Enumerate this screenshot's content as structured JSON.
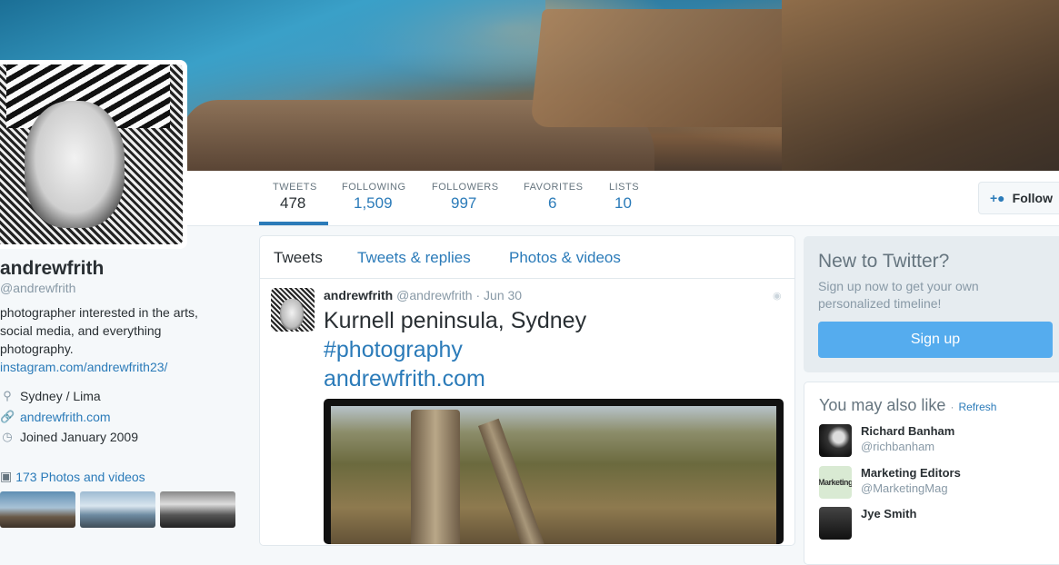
{
  "profile": {
    "name": "andrewfrith",
    "handle": "@andrewfrith",
    "bio": "photographer interested in the arts, social media, and everything photography.",
    "bio_link": "instagram.com/andrewfrith23/",
    "location": "Sydney / Lima",
    "website": "andrewfrith.com",
    "joined": "Joined January 2009",
    "photos_link": "173 Photos and videos",
    "icons": {
      "location": "map-pin-icon",
      "website": "link-icon",
      "joined": "clock-icon",
      "photos": "camera-icon"
    }
  },
  "nav": {
    "stats": [
      {
        "label": "TWEETS",
        "value": "478",
        "active": true
      },
      {
        "label": "FOLLOWING",
        "value": "1,509"
      },
      {
        "label": "FOLLOWERS",
        "value": "997"
      },
      {
        "label": "FAVORITES",
        "value": "6"
      },
      {
        "label": "LISTS",
        "value": "10"
      }
    ],
    "follow_label": "Follow"
  },
  "timeline": {
    "tabs": [
      "Tweets",
      "Tweets & replies",
      "Photos & videos"
    ],
    "active_tab": "Tweets",
    "tweet": {
      "name": "andrewfrith",
      "handle": "@andrewfrith",
      "dot": "·",
      "date": "Jun 30",
      "text": "Kurnell peninsula, Sydney",
      "hashtag": "#photography",
      "url": "andrewfrith.com"
    }
  },
  "signup": {
    "title": "New to Twitter?",
    "subtitle": "Sign up now to get your own personalized timeline!",
    "button": "Sign up"
  },
  "who_to_follow": {
    "title": "You may also like",
    "separator": "·",
    "refresh": "Refresh",
    "users": [
      {
        "name": "Richard Banham",
        "handle": "@richbanham"
      },
      {
        "name": "Marketing Editors",
        "handle": "@MarketingMag",
        "avatar_text": "Marketing"
      },
      {
        "name": "Jye Smith",
        "handle": ""
      }
    ]
  },
  "colors": {
    "accent": "#2b7bb9",
    "signup_button": "#55acee",
    "background": "#f5f8fa"
  }
}
